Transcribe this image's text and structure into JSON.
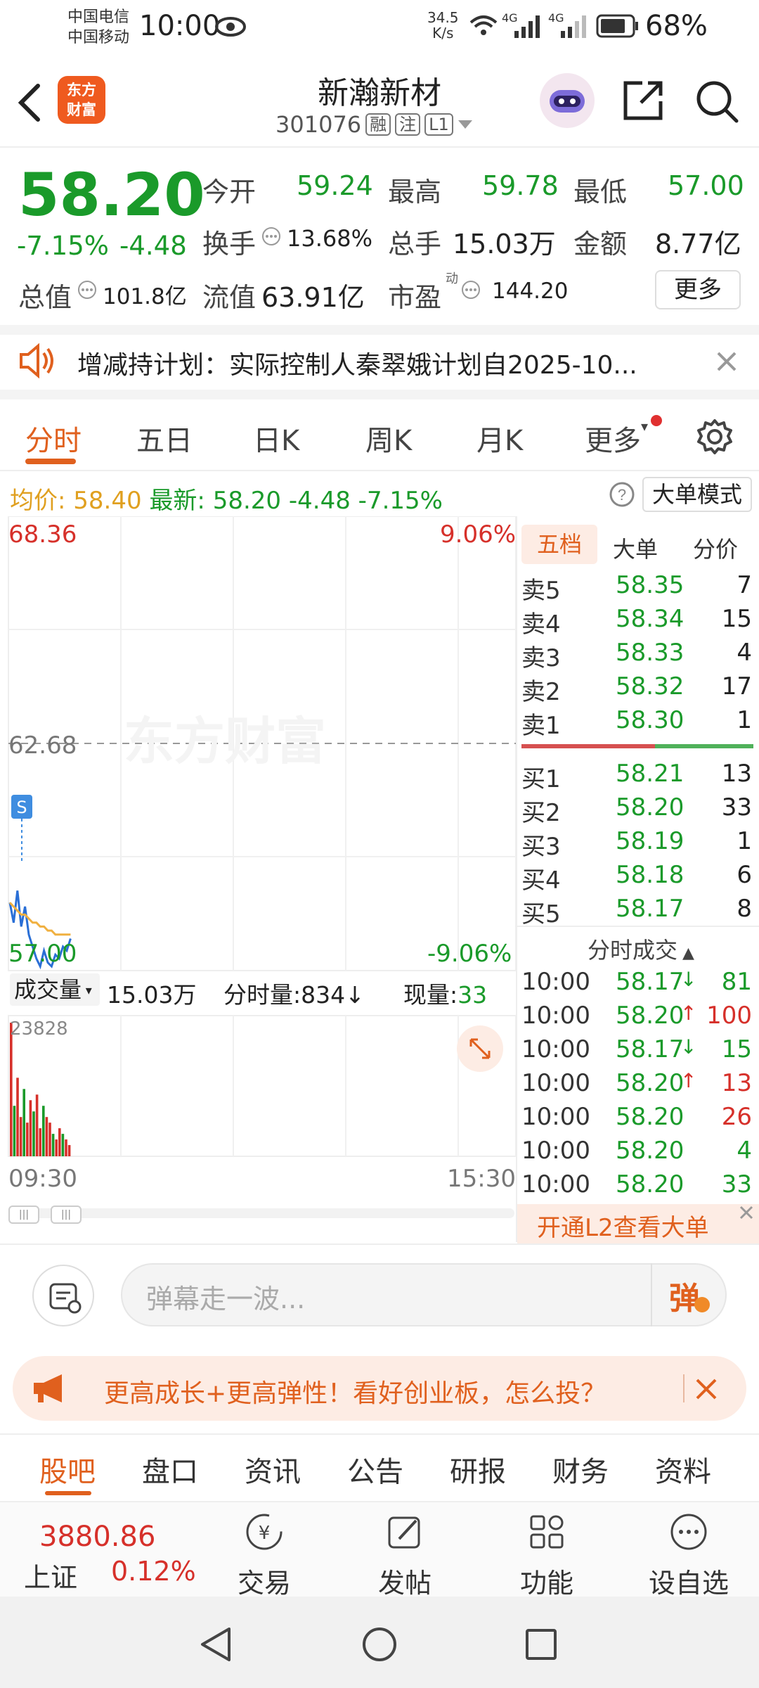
{
  "status": {
    "carrier1": "中国电信",
    "carrier2": "中国移动",
    "time": "10:00",
    "net_speed": "34.5",
    "net_unit": "K/s",
    "signal1": "4G",
    "signal2": "4G",
    "battery": "68%"
  },
  "header": {
    "logo_line1": "东方",
    "logo_line2": "财富",
    "name": "新瀚新材",
    "code": "301076",
    "tag1": "融",
    "tag2": "注",
    "tag3": "L1"
  },
  "quote": {
    "price": "58.20",
    "change_pct": "-7.15%",
    "change": "-4.48",
    "open_label": "今开",
    "open": "59.24",
    "high_label": "最高",
    "high": "59.78",
    "low_label": "最低",
    "low": "57.00",
    "turnover_label": "换手",
    "turnover": "13.68%",
    "volume_label": "总手",
    "volume": "15.03万",
    "amount_label": "金额",
    "amount": "8.77亿",
    "mktcap_label": "总值",
    "mktcap": "101.8亿",
    "float_label": "流值",
    "float": "63.91亿",
    "pe_label": "市盈",
    "pe_sup": "动",
    "pe": "144.20",
    "more": "更多"
  },
  "notice": {
    "text": "增减持计划：实际控制人秦翠娥计划自2025-10..."
  },
  "tabs": [
    "分时",
    "五日",
    "日K",
    "周K",
    "月K",
    "更多"
  ],
  "infobar": {
    "avg_label": "均价:",
    "avg": "58.40",
    "latest_label": "最新:",
    "latest": "58.20",
    "chg": "-4.48",
    "pct": "-7.15%",
    "mode": "大单模式"
  },
  "chart": {
    "y_top": "68.36",
    "y_mid": "62.68",
    "y_bot": "57.00",
    "pct_top": "9.06%",
    "pct_bot": "-9.06%",
    "watermark": "东方财富",
    "marker": "S",
    "vol_label": "成交量",
    "vol_total": "15.03万",
    "tick_vol": "分时量:834↓",
    "now_vol_label": "现量:",
    "now_vol": "33",
    "vol_max": "23828",
    "t_start": "09:30",
    "t_end": "15:30"
  },
  "chart_data": {
    "type": "line",
    "series": [
      {
        "name": "最新",
        "values": [
          58.7,
          58.2,
          59.0,
          58.1,
          58.6,
          57.9,
          57.6,
          57.3,
          57.1,
          57.5,
          57.2,
          57.0,
          57.4,
          57.3,
          57.6,
          57.5,
          57.8
        ]
      },
      {
        "name": "均价",
        "values": [
          58.7,
          58.6,
          58.5,
          58.4,
          58.4,
          58.3,
          58.2,
          58.2,
          58.1,
          58.1,
          58.0,
          58.0,
          57.9,
          57.9,
          57.9,
          57.9,
          57.9
        ]
      }
    ],
    "volume": [
      23828,
      9000,
      14000,
      7000,
      12000,
      6000,
      10000,
      8000,
      11000,
      5000,
      9000,
      7000,
      6000,
      4000,
      3000,
      5000,
      4000,
      3000,
      2000
    ],
    "ylim": [
      57.0,
      68.36
    ]
  },
  "orderbook": {
    "tabs": [
      "五档",
      "大单",
      "分价"
    ],
    "asks": [
      {
        "label": "卖5",
        "price": "58.35",
        "vol": "7"
      },
      {
        "label": "卖4",
        "price": "58.34",
        "vol": "15"
      },
      {
        "label": "卖3",
        "price": "58.33",
        "vol": "4"
      },
      {
        "label": "卖2",
        "price": "58.32",
        "vol": "17"
      },
      {
        "label": "卖1",
        "price": "58.30",
        "vol": "1"
      }
    ],
    "bids": [
      {
        "label": "买1",
        "price": "58.21",
        "vol": "13"
      },
      {
        "label": "买2",
        "price": "58.20",
        "vol": "33"
      },
      {
        "label": "买3",
        "price": "58.19",
        "vol": "1"
      },
      {
        "label": "买4",
        "price": "58.18",
        "vol": "6"
      },
      {
        "label": "买5",
        "price": "58.17",
        "vol": "8"
      }
    ],
    "ticks_title": "分时成交",
    "ticks": [
      {
        "time": "10:00",
        "price": "58.17",
        "arrow": "↓",
        "vol": "81",
        "color": "#1a9a2a",
        "vcolor": "#1a9a2a"
      },
      {
        "time": "10:00",
        "price": "58.20",
        "arrow": "↑",
        "vol": "100",
        "color": "#1a9a2a",
        "vcolor": "#d6302a"
      },
      {
        "time": "10:00",
        "price": "58.17",
        "arrow": "↓",
        "vol": "15",
        "color": "#1a9a2a",
        "vcolor": "#1a9a2a"
      },
      {
        "time": "10:00",
        "price": "58.20",
        "arrow": "↑",
        "vol": "13",
        "color": "#1a9a2a",
        "vcolor": "#d6302a"
      },
      {
        "time": "10:00",
        "price": "58.20",
        "arrow": "",
        "vol": "26",
        "color": "#1a9a2a",
        "vcolor": "#d6302a"
      },
      {
        "time": "10:00",
        "price": "58.20",
        "arrow": "",
        "vol": "4",
        "color": "#1a9a2a",
        "vcolor": "#1a9a2a"
      },
      {
        "time": "10:00",
        "price": "58.20",
        "arrow": "",
        "vol": "33",
        "color": "#1a9a2a",
        "vcolor": "#1a9a2a"
      }
    ],
    "l2": "开通L2查看大单"
  },
  "danmu": {
    "placeholder": "弹幕走一波...",
    "btn": "弹"
  },
  "banner": {
    "text": "更高成长+更高弹性！看好创业板，怎么投？"
  },
  "bottom_tabs": [
    "股吧",
    "盘口",
    "资讯",
    "公告",
    "研报",
    "财务",
    "资料"
  ],
  "bottombar": {
    "index_value": "3880.86",
    "index_name": "上证",
    "index_pct": "0.12%",
    "trade": "交易",
    "post": "发帖",
    "func": "功能",
    "watch": "设自选"
  },
  "colors": {
    "up": "#d6302a",
    "down": "#1a9a2a",
    "accent": "#e0601e"
  }
}
